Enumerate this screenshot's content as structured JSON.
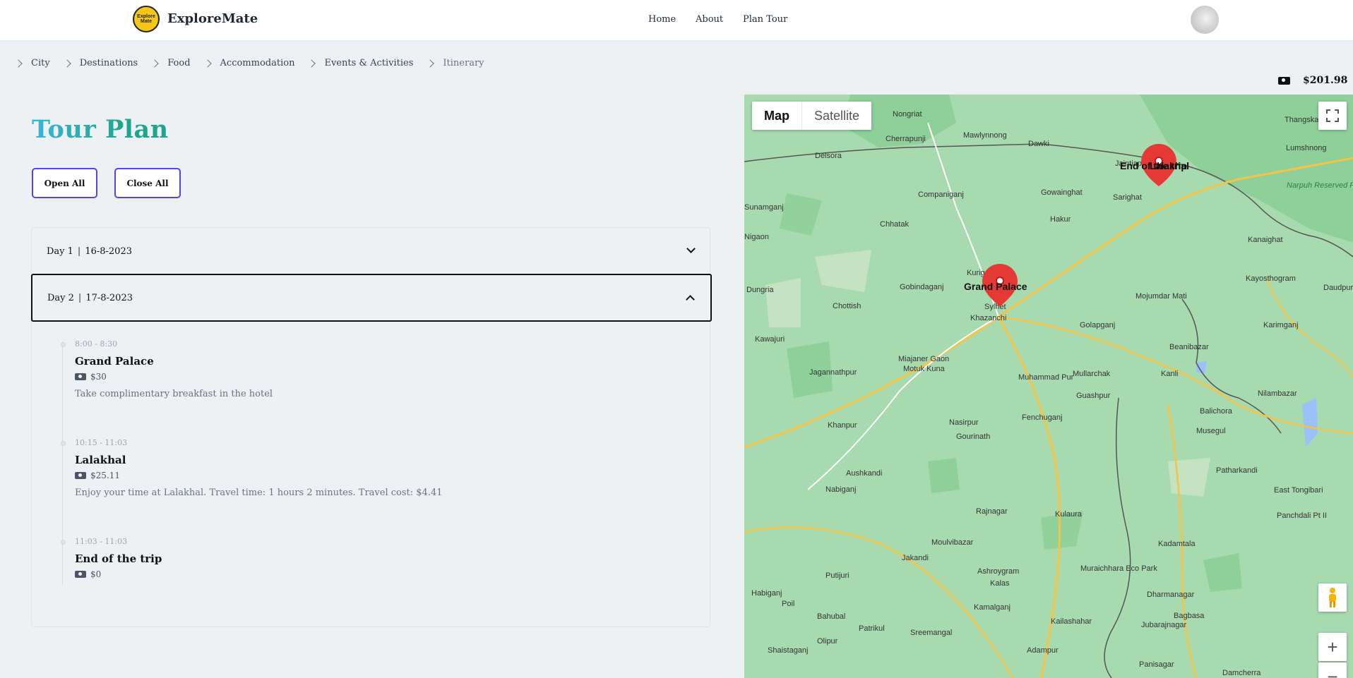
{
  "header": {
    "logo_text": "Explore Mate",
    "brand": "ExploreMate",
    "nav": [
      "Home",
      "About",
      "Plan Tour"
    ]
  },
  "breadcrumb": [
    "City",
    "Destinations",
    "Food",
    "Accommodation",
    "Events & Activities",
    "Itinerary"
  ],
  "budget": {
    "total": "$201.98",
    "icon": "cash-icon"
  },
  "tour": {
    "title": "Tour Plan",
    "open_all": "Open All",
    "close_all": "Close All"
  },
  "days": [
    {
      "label": "Day 1",
      "date": "16-8-2023",
      "expanded": false
    },
    {
      "label": "Day 2",
      "date": "17-8-2023",
      "expanded": true,
      "events": [
        {
          "time": "8:00 - 8:30",
          "title": "Grand Palace",
          "cost": "$30",
          "description": "Take complimentary breakfast in the hotel"
        },
        {
          "time": "10:15 - 11:03",
          "title": "Lalakhal",
          "cost": "$25.11",
          "description": "Enjoy your time at Lalakhal. Travel time: 1 hours 2 minutes. Travel cost: $4.41"
        },
        {
          "time": "11:03 - 11:03",
          "title": "End of the trip",
          "cost": "$0",
          "description": ""
        }
      ]
    }
  ],
  "map": {
    "type_options": [
      "Map",
      "Satellite"
    ],
    "selected_type": "Map",
    "markers": [
      "Grand Palace",
      "End of the trip",
      "Lalakhal"
    ],
    "places": [
      "Cherrapunji",
      "Nongriat",
      "Mawlynnong",
      "Dawki",
      "Thangskai",
      "Lumshnong",
      "Delsora",
      "Jaintiapur",
      "Sarighat",
      "Gowainghat",
      "Companiganj",
      "Sunamganj",
      "Chhatak",
      "Hakur",
      "Kanaighat",
      "Kurigaon",
      "Gobindaganj",
      "Sylhet",
      "Kayosthogram",
      "Daudpur",
      "Mojumdar Mati",
      "Chottish",
      "Khazanchi",
      "Golapganj",
      "Karimganj",
      "Beanibazar",
      "Kawajuri",
      "Miajaner Gaon",
      "Motuk Kuna",
      "Jagannathpur",
      "Mullarchak",
      "Kanli",
      "Muhammad Pur",
      "Nilambazar",
      "Guashpur",
      "Fenchuganj",
      "Balichora",
      "Nasirpur",
      "Musegul",
      "Khanpur",
      "Gourinath",
      "Aushkandi",
      "Patharkandi",
      "Nabiganj",
      "East Tongibari",
      "Kulaura",
      "Rajnagar",
      "Panchdali Pt II",
      "Kadamtala",
      "Moulvibazar",
      "Jakandi",
      "Ashroygram",
      "Muraichhara Eco Park",
      "Putijuri",
      "Dharmanagar",
      "Habiganj",
      "Kalas",
      "Poil",
      "Bahubal",
      "Kamalganj",
      "Kailashahar",
      "Bagbasa",
      "Olipur",
      "Patrikul",
      "Sreemangal",
      "Jubarajnagar",
      "Shaistaganj",
      "Adampur",
      "Panisagar",
      "Damcherra",
      "Narpuh Reserved Forest",
      "Dungria",
      "Nigaon"
    ],
    "colors": {
      "land": "#a8dab0",
      "forest": "#8fcf9a",
      "water": "#9cc0f9",
      "road": "#f6c445",
      "marker": "#e53935"
    }
  }
}
